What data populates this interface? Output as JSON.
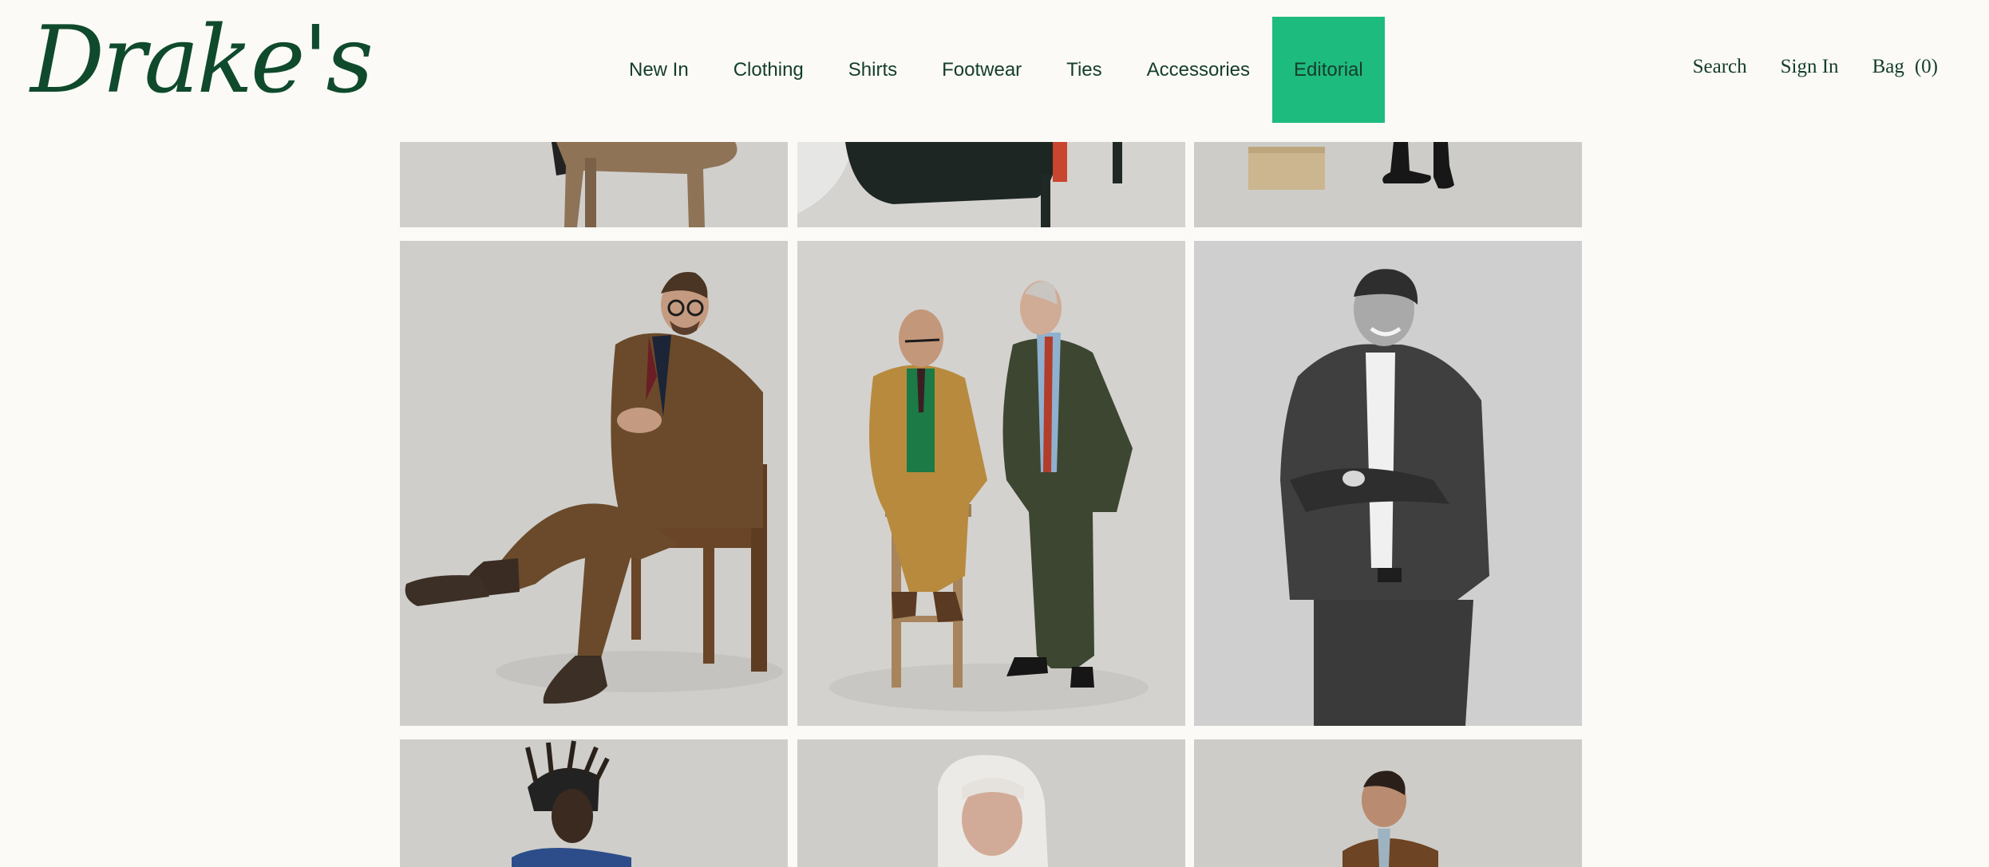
{
  "brand": {
    "logo_text": "Drake's",
    "primary_color": "#0f4a2c",
    "accent_color": "#1ebb7f",
    "background_color": "#fbfaf6"
  },
  "nav": {
    "items": [
      {
        "label": "New In"
      },
      {
        "label": "Clothing"
      },
      {
        "label": "Shirts"
      },
      {
        "label": "Footwear"
      },
      {
        "label": "Ties"
      },
      {
        "label": "Accessories"
      },
      {
        "label": "Editorial",
        "active": true
      }
    ]
  },
  "utility": {
    "search_label": "Search",
    "sign_in_label": "Sign In",
    "bag_label": "Bag",
    "bag_count": "(0)"
  },
  "gallery": {
    "images": [
      {
        "icon": "photo-dog-legs"
      },
      {
        "icon": "photo-chair-detail"
      },
      {
        "icon": "photo-box-shoes"
      },
      {
        "icon": "photo-man-seated-brown-suit"
      },
      {
        "icon": "photo-two-men-corduroy"
      },
      {
        "icon": "photo-man-dark-jacket-bw"
      },
      {
        "icon": "photo-man-dreadlocks"
      },
      {
        "icon": "photo-woman-grey-hair"
      },
      {
        "icon": "photo-man-brown-jacket"
      }
    ]
  }
}
